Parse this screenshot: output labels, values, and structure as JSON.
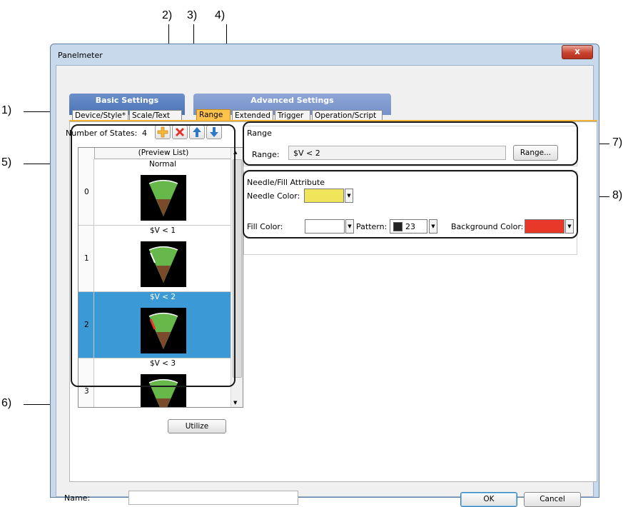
{
  "callouts": [
    "1)",
    "2)",
    "3)",
    "4)",
    "5)",
    "6)",
    "7)",
    "8)"
  ],
  "window": {
    "title": "Panelmeter",
    "close_label": "x"
  },
  "tab_groups": {
    "basic": "Basic Settings",
    "advanced": "Advanced Settings"
  },
  "tabs": [
    "Device/Style*",
    "Scale/Text",
    "Range",
    "Extended",
    "Trigger",
    "Operation/Script"
  ],
  "active_tab": "Range",
  "states": {
    "label": "Number of States:",
    "count": "4"
  },
  "toolbar_icons": [
    "add-state-icon",
    "delete-state-icon",
    "move-up-icon",
    "move-down-icon"
  ],
  "preview": {
    "header": "(Preview List)",
    "rows": [
      {
        "index": "0",
        "label": "Normal"
      },
      {
        "index": "1",
        "label": "$V < 1"
      },
      {
        "index": "2",
        "label": "$V < 2"
      },
      {
        "index": "3",
        "label": "$V < 3"
      }
    ],
    "selected_index": "2"
  },
  "utilize_label": "Utilize",
  "range": {
    "group_title": "Range",
    "label": "Range:",
    "value": "$V < 2",
    "button": "Range..."
  },
  "needle_fill": {
    "group_title": "Needle/Fill Attribute",
    "needle_color_label": "Needle Color:",
    "fill_color_label": "Fill Color:",
    "pattern_label": "Pattern:",
    "pattern_value": "23",
    "background_color_label": "Background Color:",
    "needle_color": "#f0e55a",
    "fill_color": "#ffffff",
    "background_color": "#e8382a"
  },
  "name_label": "Name:",
  "name_value": "",
  "ok_label": "OK",
  "cancel_label": "Cancel",
  "colors": {
    "gauge_green": "#66b84a",
    "gauge_brown": "#7a4a2a",
    "selection": "#3b99d5",
    "active_tab": "#ffc24a"
  }
}
